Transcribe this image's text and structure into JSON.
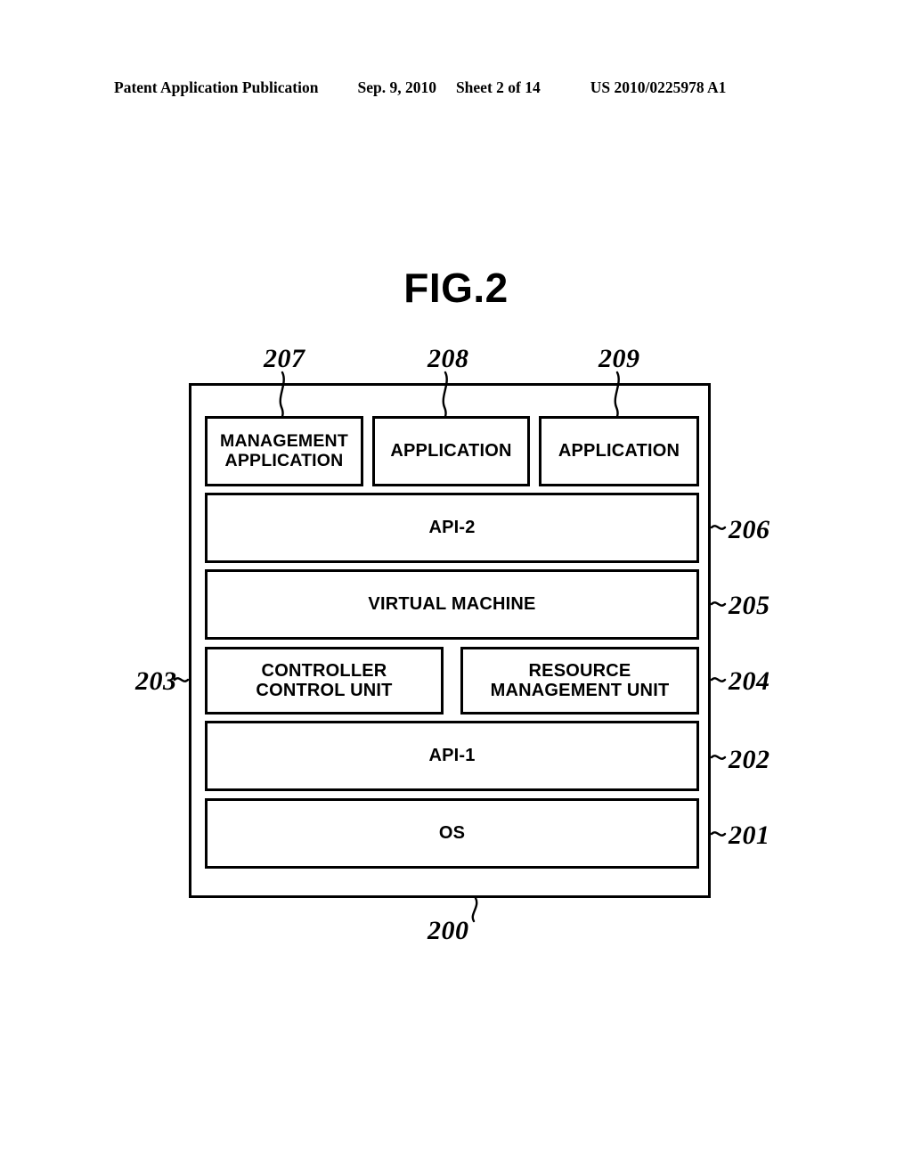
{
  "header": {
    "publication": "Patent Application Publication",
    "date": "Sep. 9, 2010",
    "sheet": "Sheet 2 of 14",
    "patent_number": "US 2010/0225978 A1"
  },
  "figure": {
    "title": "FIG.2",
    "outer_reference": "200"
  },
  "blocks": [
    {
      "id": "management-application",
      "label": "MANAGEMENT\nAPPLICATION",
      "reference": "207"
    },
    {
      "id": "application-1",
      "label": "APPLICATION",
      "reference": "208"
    },
    {
      "id": "application-2",
      "label": "APPLICATION",
      "reference": "209"
    },
    {
      "id": "api-2",
      "label": "API-2",
      "reference": "206"
    },
    {
      "id": "virtual-machine",
      "label": "VIRTUAL MACHINE",
      "reference": "205"
    },
    {
      "id": "controller-control-unit",
      "label": "CONTROLLER\nCONTROL UNIT",
      "reference": "203"
    },
    {
      "id": "resource-management-unit",
      "label": "RESOURCE\nMANAGEMENT UNIT",
      "reference": "204"
    },
    {
      "id": "api-1",
      "label": "API-1",
      "reference": "202"
    },
    {
      "id": "os",
      "label": "OS",
      "reference": "201"
    }
  ],
  "colors": {
    "stroke": "#000000",
    "background": "#ffffff"
  }
}
